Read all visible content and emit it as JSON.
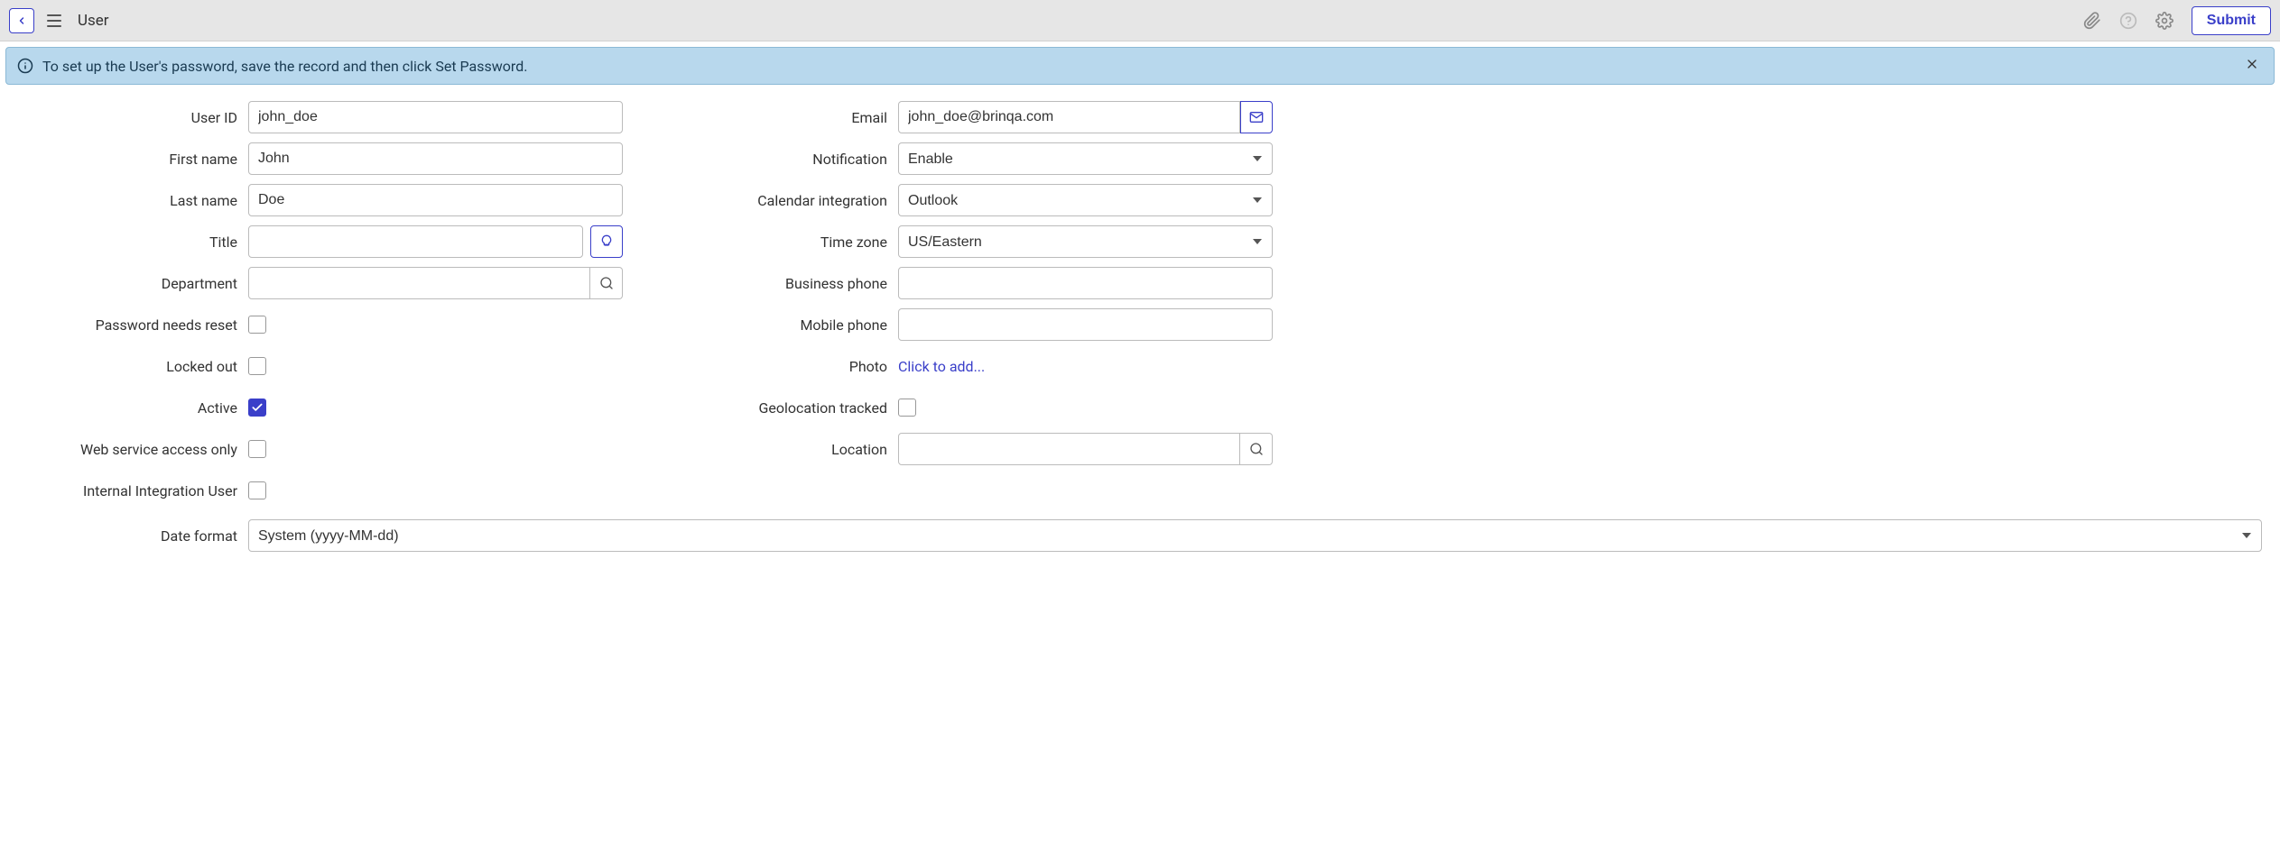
{
  "header": {
    "title": "User",
    "submit_label": "Submit"
  },
  "banner": {
    "message": "To set up the User's password, save the record and then click Set Password."
  },
  "left": {
    "user_id": {
      "label": "User ID",
      "value": "john_doe"
    },
    "first_name": {
      "label": "First name",
      "value": "John"
    },
    "last_name": {
      "label": "Last name",
      "value": "Doe"
    },
    "title": {
      "label": "Title",
      "value": ""
    },
    "department": {
      "label": "Department",
      "value": ""
    },
    "password_needs_reset": {
      "label": "Password needs reset",
      "checked": false
    },
    "locked_out": {
      "label": "Locked out",
      "checked": false
    },
    "active": {
      "label": "Active",
      "checked": true
    },
    "web_service_access_only": {
      "label": "Web service access only",
      "checked": false
    },
    "internal_integration_user": {
      "label": "Internal Integration User",
      "checked": false
    }
  },
  "right": {
    "email": {
      "label": "Email",
      "value": "john_doe@brinqa.com"
    },
    "notification": {
      "label": "Notification",
      "value": "Enable"
    },
    "calendar_integration": {
      "label": "Calendar integration",
      "value": "Outlook"
    },
    "time_zone": {
      "label": "Time zone",
      "value": "US/Eastern"
    },
    "business_phone": {
      "label": "Business phone",
      "value": ""
    },
    "mobile_phone": {
      "label": "Mobile phone",
      "value": ""
    },
    "photo": {
      "label": "Photo",
      "link": "Click to add..."
    },
    "geolocation_tracked": {
      "label": "Geolocation tracked",
      "checked": false
    },
    "location": {
      "label": "Location",
      "value": ""
    }
  },
  "bottom": {
    "date_format": {
      "label": "Date format",
      "value": "System (yyyy-MM-dd)"
    }
  }
}
